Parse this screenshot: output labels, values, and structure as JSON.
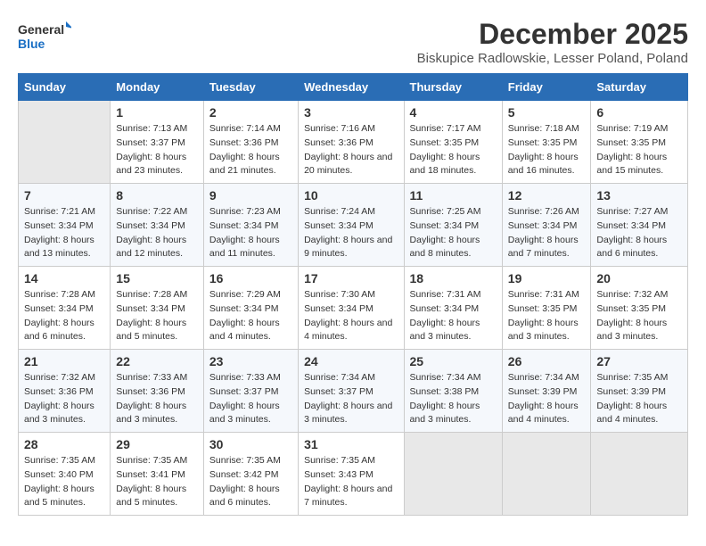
{
  "logo": {
    "line1": "General",
    "line2": "Blue"
  },
  "title": "December 2025",
  "location": "Biskupice Radlowskie, Lesser Poland, Poland",
  "weekdays": [
    "Sunday",
    "Monday",
    "Tuesday",
    "Wednesday",
    "Thursday",
    "Friday",
    "Saturday"
  ],
  "weeks": [
    [
      {
        "day": "",
        "sunrise": "",
        "sunset": "",
        "daylight": ""
      },
      {
        "day": "1",
        "sunrise": "Sunrise: 7:13 AM",
        "sunset": "Sunset: 3:37 PM",
        "daylight": "Daylight: 8 hours and 23 minutes."
      },
      {
        "day": "2",
        "sunrise": "Sunrise: 7:14 AM",
        "sunset": "Sunset: 3:36 PM",
        "daylight": "Daylight: 8 hours and 21 minutes."
      },
      {
        "day": "3",
        "sunrise": "Sunrise: 7:16 AM",
        "sunset": "Sunset: 3:36 PM",
        "daylight": "Daylight: 8 hours and 20 minutes."
      },
      {
        "day": "4",
        "sunrise": "Sunrise: 7:17 AM",
        "sunset": "Sunset: 3:35 PM",
        "daylight": "Daylight: 8 hours and 18 minutes."
      },
      {
        "day": "5",
        "sunrise": "Sunrise: 7:18 AM",
        "sunset": "Sunset: 3:35 PM",
        "daylight": "Daylight: 8 hours and 16 minutes."
      },
      {
        "day": "6",
        "sunrise": "Sunrise: 7:19 AM",
        "sunset": "Sunset: 3:35 PM",
        "daylight": "Daylight: 8 hours and 15 minutes."
      }
    ],
    [
      {
        "day": "7",
        "sunrise": "Sunrise: 7:21 AM",
        "sunset": "Sunset: 3:34 PM",
        "daylight": "Daylight: 8 hours and 13 minutes."
      },
      {
        "day": "8",
        "sunrise": "Sunrise: 7:22 AM",
        "sunset": "Sunset: 3:34 PM",
        "daylight": "Daylight: 8 hours and 12 minutes."
      },
      {
        "day": "9",
        "sunrise": "Sunrise: 7:23 AM",
        "sunset": "Sunset: 3:34 PM",
        "daylight": "Daylight: 8 hours and 11 minutes."
      },
      {
        "day": "10",
        "sunrise": "Sunrise: 7:24 AM",
        "sunset": "Sunset: 3:34 PM",
        "daylight": "Daylight: 8 hours and 9 minutes."
      },
      {
        "day": "11",
        "sunrise": "Sunrise: 7:25 AM",
        "sunset": "Sunset: 3:34 PM",
        "daylight": "Daylight: 8 hours and 8 minutes."
      },
      {
        "day": "12",
        "sunrise": "Sunrise: 7:26 AM",
        "sunset": "Sunset: 3:34 PM",
        "daylight": "Daylight: 8 hours and 7 minutes."
      },
      {
        "day": "13",
        "sunrise": "Sunrise: 7:27 AM",
        "sunset": "Sunset: 3:34 PM",
        "daylight": "Daylight: 8 hours and 6 minutes."
      }
    ],
    [
      {
        "day": "14",
        "sunrise": "Sunrise: 7:28 AM",
        "sunset": "Sunset: 3:34 PM",
        "daylight": "Daylight: 8 hours and 6 minutes."
      },
      {
        "day": "15",
        "sunrise": "Sunrise: 7:28 AM",
        "sunset": "Sunset: 3:34 PM",
        "daylight": "Daylight: 8 hours and 5 minutes."
      },
      {
        "day": "16",
        "sunrise": "Sunrise: 7:29 AM",
        "sunset": "Sunset: 3:34 PM",
        "daylight": "Daylight: 8 hours and 4 minutes."
      },
      {
        "day": "17",
        "sunrise": "Sunrise: 7:30 AM",
        "sunset": "Sunset: 3:34 PM",
        "daylight": "Daylight: 8 hours and 4 minutes."
      },
      {
        "day": "18",
        "sunrise": "Sunrise: 7:31 AM",
        "sunset": "Sunset: 3:34 PM",
        "daylight": "Daylight: 8 hours and 3 minutes."
      },
      {
        "day": "19",
        "sunrise": "Sunrise: 7:31 AM",
        "sunset": "Sunset: 3:35 PM",
        "daylight": "Daylight: 8 hours and 3 minutes."
      },
      {
        "day": "20",
        "sunrise": "Sunrise: 7:32 AM",
        "sunset": "Sunset: 3:35 PM",
        "daylight": "Daylight: 8 hours and 3 minutes."
      }
    ],
    [
      {
        "day": "21",
        "sunrise": "Sunrise: 7:32 AM",
        "sunset": "Sunset: 3:36 PM",
        "daylight": "Daylight: 8 hours and 3 minutes."
      },
      {
        "day": "22",
        "sunrise": "Sunrise: 7:33 AM",
        "sunset": "Sunset: 3:36 PM",
        "daylight": "Daylight: 8 hours and 3 minutes."
      },
      {
        "day": "23",
        "sunrise": "Sunrise: 7:33 AM",
        "sunset": "Sunset: 3:37 PM",
        "daylight": "Daylight: 8 hours and 3 minutes."
      },
      {
        "day": "24",
        "sunrise": "Sunrise: 7:34 AM",
        "sunset": "Sunset: 3:37 PM",
        "daylight": "Daylight: 8 hours and 3 minutes."
      },
      {
        "day": "25",
        "sunrise": "Sunrise: 7:34 AM",
        "sunset": "Sunset: 3:38 PM",
        "daylight": "Daylight: 8 hours and 3 minutes."
      },
      {
        "day": "26",
        "sunrise": "Sunrise: 7:34 AM",
        "sunset": "Sunset: 3:39 PM",
        "daylight": "Daylight: 8 hours and 4 minutes."
      },
      {
        "day": "27",
        "sunrise": "Sunrise: 7:35 AM",
        "sunset": "Sunset: 3:39 PM",
        "daylight": "Daylight: 8 hours and 4 minutes."
      }
    ],
    [
      {
        "day": "28",
        "sunrise": "Sunrise: 7:35 AM",
        "sunset": "Sunset: 3:40 PM",
        "daylight": "Daylight: 8 hours and 5 minutes."
      },
      {
        "day": "29",
        "sunrise": "Sunrise: 7:35 AM",
        "sunset": "Sunset: 3:41 PM",
        "daylight": "Daylight: 8 hours and 5 minutes."
      },
      {
        "day": "30",
        "sunrise": "Sunrise: 7:35 AM",
        "sunset": "Sunset: 3:42 PM",
        "daylight": "Daylight: 8 hours and 6 minutes."
      },
      {
        "day": "31",
        "sunrise": "Sunrise: 7:35 AM",
        "sunset": "Sunset: 3:43 PM",
        "daylight": "Daylight: 8 hours and 7 minutes."
      },
      {
        "day": "",
        "sunrise": "",
        "sunset": "",
        "daylight": ""
      },
      {
        "day": "",
        "sunrise": "",
        "sunset": "",
        "daylight": ""
      },
      {
        "day": "",
        "sunrise": "",
        "sunset": "",
        "daylight": ""
      }
    ]
  ]
}
